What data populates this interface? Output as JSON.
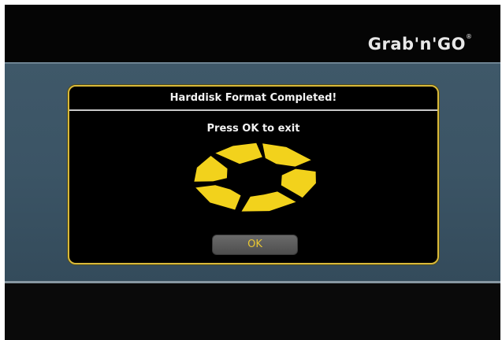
{
  "brand": {
    "logo_text": "Grab'n'GO",
    "registered_mark": "®"
  },
  "dialog": {
    "title": "Harddisk Format Completed!",
    "message": "Press OK to exit",
    "ok_label": "OK",
    "icon": "spinner-wheel-icon"
  },
  "colors": {
    "dialog_border": "#d9b93a",
    "spinner_segment": "#f2d21c",
    "ok_text": "#e8c732",
    "band_background": "#3b5465"
  }
}
